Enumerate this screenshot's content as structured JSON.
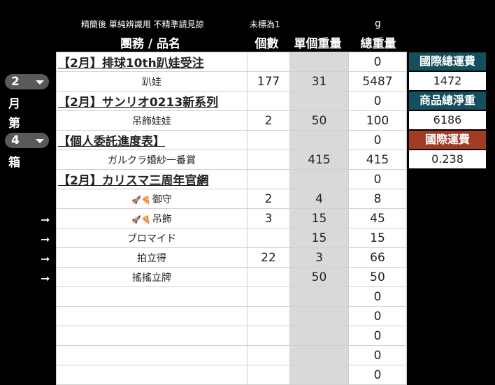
{
  "notes": {
    "left": "精簡後 單純辨識用 不精準請見諒",
    "mid": "未標為1",
    "unit": "g"
  },
  "headers": {
    "name": "團務 / 品名",
    "qty": "個數",
    "unit_weight": "單個重量",
    "total_weight": "總重量"
  },
  "rows": [
    {
      "name": "【2月】排球10th趴娃受注",
      "qty": "",
      "unit": "",
      "total": "0",
      "title": true
    },
    {
      "name": "趴娃",
      "qty": "177",
      "unit": "31",
      "total": "5487"
    },
    {
      "name": "【2月】サンリオ0213新系列",
      "qty": "",
      "unit": "",
      "total": "0",
      "title": true
    },
    {
      "name": "吊飾娃娃",
      "qty": "2",
      "unit": "50",
      "total": "100"
    },
    {
      "name": "【個人委託進度表】",
      "qty": "",
      "unit": "",
      "total": "0",
      "title": true
    },
    {
      "name": "ガルクラ婚紗一番賞",
      "qty": "",
      "unit": "415",
      "total": "415"
    },
    {
      "name": "【2月】カリスマ三周年官網",
      "qty": "",
      "unit": "",
      "total": "0",
      "title": true
    },
    {
      "name": "御守",
      "emoji": "🚀🍕",
      "qty": "2",
      "unit": "4",
      "total": "8"
    },
    {
      "name": "吊飾",
      "emoji": "🚀🍕",
      "qty": "3",
      "unit": "15",
      "total": "45"
    },
    {
      "name": "ブロマイド",
      "qty": "",
      "unit": "15",
      "total": "15"
    },
    {
      "name": "拍立得",
      "qty": "22",
      "unit": "3",
      "total": "66"
    },
    {
      "name": "搖搖立牌",
      "qty": "",
      "unit": "50",
      "total": "50"
    },
    {
      "name": "",
      "qty": "",
      "unit": "",
      "total": "0"
    },
    {
      "name": "",
      "qty": "",
      "unit": "",
      "total": "0"
    },
    {
      "name": "",
      "qty": "",
      "unit": "",
      "total": "0"
    },
    {
      "name": "",
      "qty": "",
      "unit": "",
      "total": "0"
    },
    {
      "name": "",
      "qty": "",
      "unit": "",
      "total": "0"
    }
  ],
  "summary": {
    "intl_total_shipping_label": "國際總運費",
    "intl_total_shipping_value": "1472",
    "net_weight_label": "商品總淨重",
    "net_weight_value": "6186",
    "intl_shipping_label": "國際運費",
    "intl_shipping_value": "0.238"
  },
  "side": {
    "month_value": "2",
    "month_label": "月",
    "ordinal_label": "第",
    "box_value": "4",
    "box_label": "箱",
    "arrow": "➞"
  },
  "colors": {
    "teal": "#134f5c",
    "red": "#a23b24",
    "dropdown": "#595959",
    "weight_col": "#d9d9d9"
  }
}
